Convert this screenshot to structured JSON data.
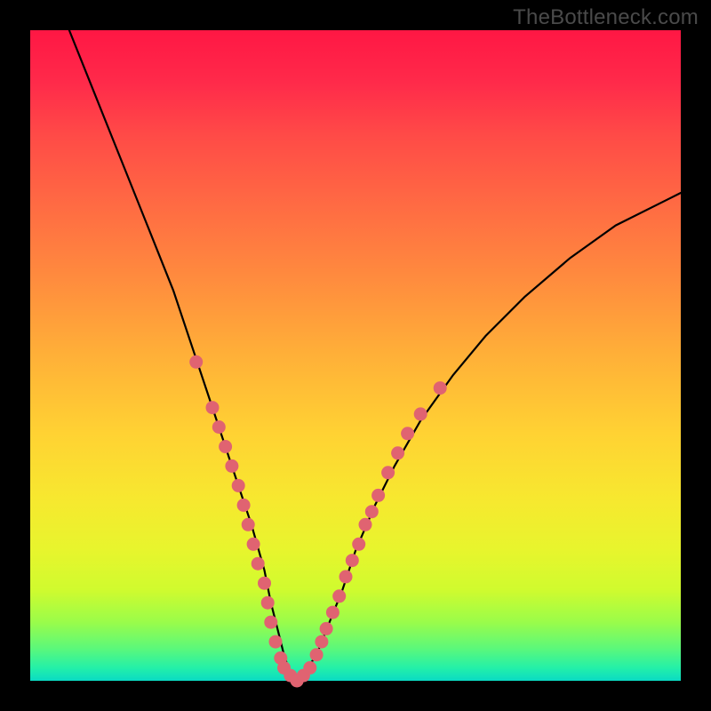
{
  "watermark": "TheBottleneck.com",
  "chart_data": {
    "type": "line",
    "title": "",
    "xlabel": "",
    "ylabel": "",
    "xlim": [
      0,
      100
    ],
    "ylim": [
      0,
      100
    ],
    "series": [
      {
        "name": "bottleneck-curve",
        "x": [
          6,
          10,
          14,
          18,
          22,
          25,
          28,
          30,
          32,
          34,
          36,
          37,
          38,
          39,
          40,
          41,
          42,
          44,
          46,
          48,
          50,
          53,
          56,
          60,
          65,
          70,
          76,
          83,
          90,
          98,
          100
        ],
        "y": [
          100,
          90,
          80,
          70,
          60,
          51,
          42,
          36,
          30,
          24,
          17,
          12,
          8,
          4,
          1,
          0,
          1,
          4,
          9,
          14,
          20,
          27,
          33,
          40,
          47,
          53,
          59,
          65,
          70,
          74,
          75
        ]
      }
    ],
    "markers": {
      "name": "highlight-dots",
      "points": [
        {
          "x": 25.5,
          "y": 49
        },
        {
          "x": 28,
          "y": 42
        },
        {
          "x": 29,
          "y": 39
        },
        {
          "x": 30,
          "y": 36
        },
        {
          "x": 31,
          "y": 33
        },
        {
          "x": 32,
          "y": 30
        },
        {
          "x": 32.8,
          "y": 27
        },
        {
          "x": 33.5,
          "y": 24
        },
        {
          "x": 34.3,
          "y": 21
        },
        {
          "x": 35,
          "y": 18
        },
        {
          "x": 36,
          "y": 15
        },
        {
          "x": 36.5,
          "y": 12
        },
        {
          "x": 37,
          "y": 9
        },
        {
          "x": 37.7,
          "y": 6
        },
        {
          "x": 38.5,
          "y": 3.5
        },
        {
          "x": 39,
          "y": 2
        },
        {
          "x": 40,
          "y": 0.8
        },
        {
          "x": 41,
          "y": 0
        },
        {
          "x": 42,
          "y": 0.8
        },
        {
          "x": 43,
          "y": 2
        },
        {
          "x": 44,
          "y": 4
        },
        {
          "x": 44.8,
          "y": 6
        },
        {
          "x": 45.5,
          "y": 8
        },
        {
          "x": 46.5,
          "y": 10.5
        },
        {
          "x": 47.5,
          "y": 13
        },
        {
          "x": 48.5,
          "y": 16
        },
        {
          "x": 49.5,
          "y": 18.5
        },
        {
          "x": 50.5,
          "y": 21
        },
        {
          "x": 51.5,
          "y": 24
        },
        {
          "x": 52.5,
          "y": 26
        },
        {
          "x": 53.5,
          "y": 28.5
        },
        {
          "x": 55,
          "y": 32
        },
        {
          "x": 56.5,
          "y": 35
        },
        {
          "x": 58,
          "y": 38
        },
        {
          "x": 60,
          "y": 41
        },
        {
          "x": 63,
          "y": 45
        }
      ]
    },
    "colors": {
      "curve": "#000000",
      "marker": "#e06371"
    }
  }
}
